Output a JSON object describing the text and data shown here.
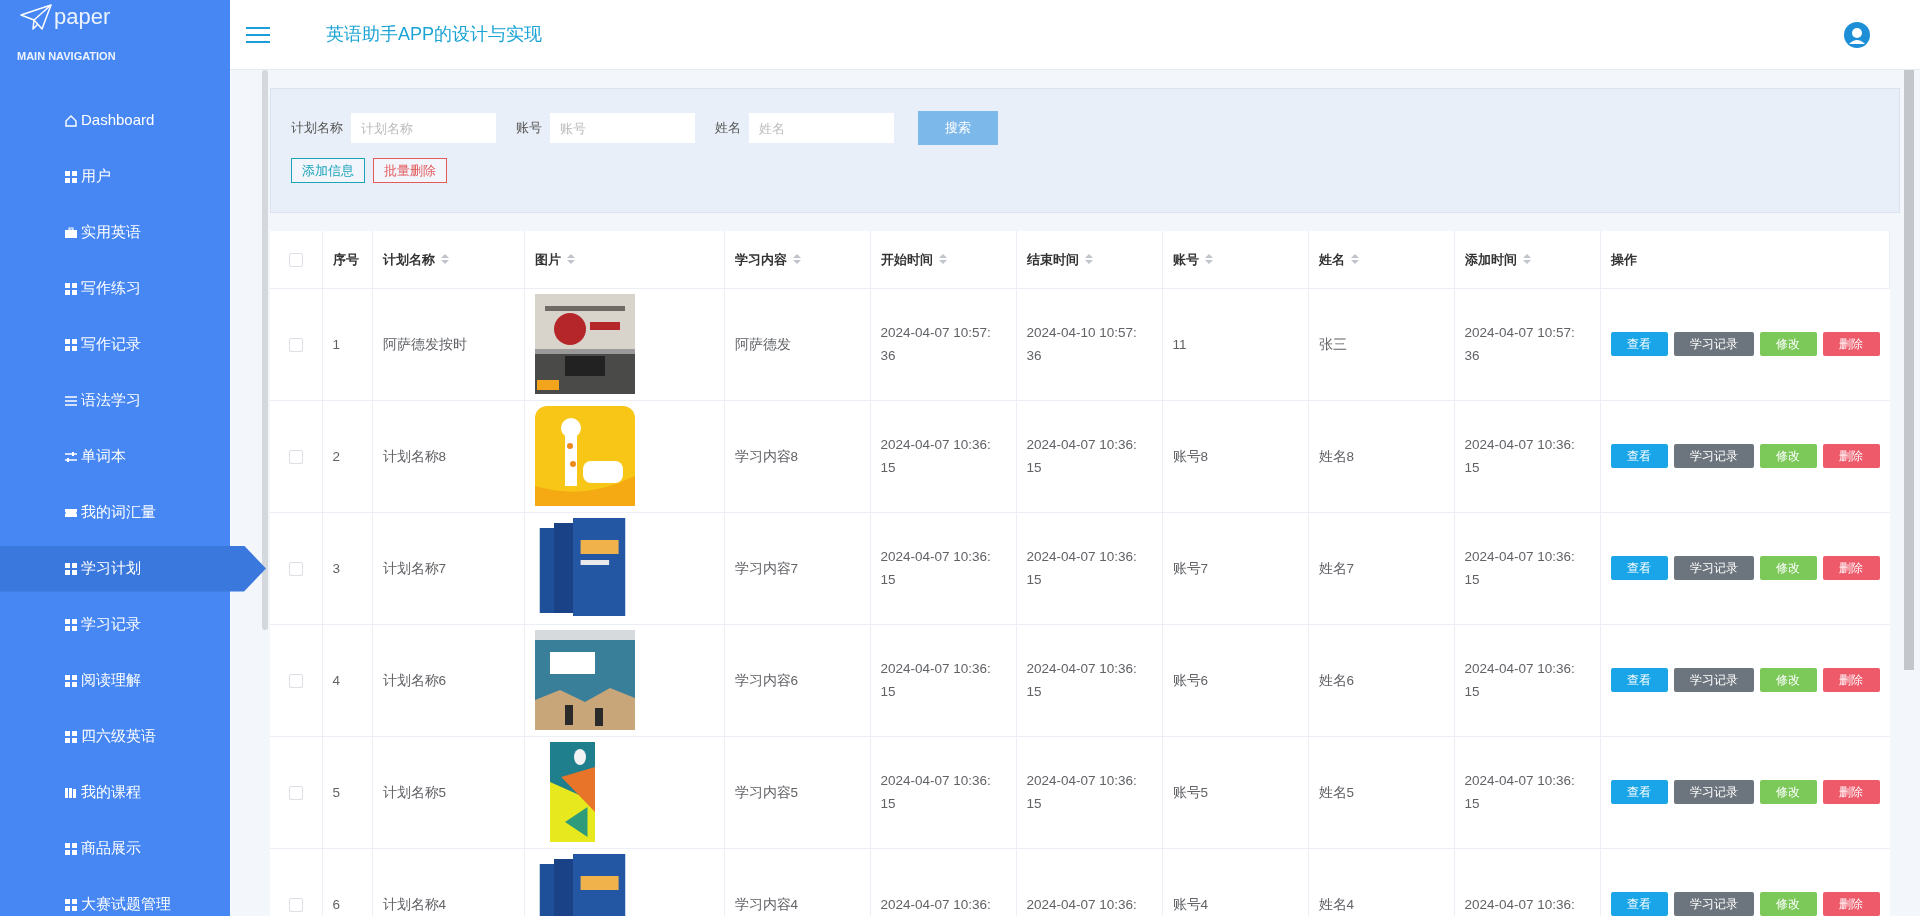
{
  "sidebar": {
    "logo": "paper",
    "section": "MAIN NAVIGATION",
    "items": [
      {
        "label": "Dashboard",
        "kind": "home",
        "selected": false
      },
      {
        "label": "用户",
        "kind": "grid",
        "selected": false
      },
      {
        "label": "实用英语",
        "kind": "briefcase",
        "selected": false
      },
      {
        "label": "写作练习",
        "kind": "grid",
        "selected": false
      },
      {
        "label": "写作记录",
        "kind": "grid",
        "selected": false
      },
      {
        "label": "语法学习",
        "kind": "list",
        "selected": false
      },
      {
        "label": "单词本",
        "kind": "sliders",
        "selected": false
      },
      {
        "label": "我的词汇量",
        "kind": "ticket",
        "selected": false
      },
      {
        "label": "学习计划",
        "kind": "grid",
        "selected": true
      },
      {
        "label": "学习记录",
        "kind": "grid",
        "selected": false
      },
      {
        "label": "阅读理解",
        "kind": "grid",
        "selected": false
      },
      {
        "label": "四六级英语",
        "kind": "grid",
        "selected": false
      },
      {
        "label": "我的课程",
        "kind": "book",
        "selected": false
      },
      {
        "label": "商品展示",
        "kind": "grid",
        "selected": false
      },
      {
        "label": "大赛试题管理",
        "kind": "grid",
        "selected": false
      }
    ]
  },
  "header": {
    "title": "英语助手APP的设计与实现"
  },
  "search": {
    "fields": [
      {
        "label": "计划名称",
        "placeholder": "计划名称"
      },
      {
        "label": "账号",
        "placeholder": "账号"
      },
      {
        "label": "姓名",
        "placeholder": "姓名"
      }
    ],
    "button": "搜索",
    "actions": [
      {
        "label": "添加信息",
        "color": "#1ba3b8"
      },
      {
        "label": "批量删除",
        "color": "#e35a5a"
      }
    ]
  },
  "table": {
    "select_all": {
      "checked": false
    },
    "columns": [
      {
        "label": "序号",
        "sortable": false
      },
      {
        "label": "计划名称",
        "sortable": true
      },
      {
        "label": "图片",
        "sortable": true
      },
      {
        "label": "学习内容",
        "sortable": true
      },
      {
        "label": "开始时间",
        "sortable": true
      },
      {
        "label": "结束时间",
        "sortable": true
      },
      {
        "label": "账号",
        "sortable": true
      },
      {
        "label": "姓名",
        "sortable": true
      },
      {
        "label": "添加时间",
        "sortable": true
      },
      {
        "label": "操作",
        "sortable": false
      }
    ],
    "rows": [
      {
        "checked": false,
        "cells": [
          "1",
          "阿萨德发按时",
          "",
          "阿萨德发",
          "2024-04-07 10:57:\n36",
          "2024-04-10 10:57:\n36",
          "11",
          "张三",
          "2024-04-07 10:57:\n36"
        ],
        "actions": [
          {
            "label": "查看",
            "color": "#1aa5e8"
          },
          {
            "label": "学习记录",
            "color": "#6c757d"
          },
          {
            "label": "修改",
            "color": "#7cc95a"
          },
          {
            "label": "删除",
            "color": "#ee5a6a"
          }
        ]
      },
      {
        "checked": false,
        "cells": [
          "2",
          "计划名称8",
          "",
          "学习内容8",
          "2024-04-07 10:36:\n15",
          "2024-04-07 10:36:\n15",
          "账号8",
          "姓名8",
          "2024-04-07 10:36:\n15"
        ],
        "actions": [
          {
            "label": "查看",
            "color": "#1aa5e8"
          },
          {
            "label": "学习记录",
            "color": "#6c757d"
          },
          {
            "label": "修改",
            "color": "#7cc95a"
          },
          {
            "label": "删除",
            "color": "#ee5a6a"
          }
        ]
      },
      {
        "checked": false,
        "cells": [
          "3",
          "计划名称7",
          "",
          "学习内容7",
          "2024-04-07 10:36:\n15",
          "2024-04-07 10:36:\n15",
          "账号7",
          "姓名7",
          "2024-04-07 10:36:\n15"
        ],
        "actions": [
          {
            "label": "查看",
            "color": "#1aa5e8"
          },
          {
            "label": "学习记录",
            "color": "#6c757d"
          },
          {
            "label": "修改",
            "color": "#7cc95a"
          },
          {
            "label": "删除",
            "color": "#ee5a6a"
          }
        ]
      },
      {
        "checked": false,
        "cells": [
          "4",
          "计划名称6",
          "",
          "学习内容6",
          "2024-04-07 10:36:\n15",
          "2024-04-07 10:36:\n15",
          "账号6",
          "姓名6",
          "2024-04-07 10:36:\n15"
        ],
        "actions": [
          {
            "label": "查看",
            "color": "#1aa5e8"
          },
          {
            "label": "学习记录",
            "color": "#6c757d"
          },
          {
            "label": "修改",
            "color": "#7cc95a"
          },
          {
            "label": "删除",
            "color": "#ee5a6a"
          }
        ]
      },
      {
        "checked": false,
        "cells": [
          "5",
          "计划名称5",
          "",
          "学习内容5",
          "2024-04-07 10:36:\n15",
          "2024-04-07 10:36:\n15",
          "账号5",
          "姓名5",
          "2024-04-07 10:36:\n15"
        ],
        "actions": [
          {
            "label": "查看",
            "color": "#1aa5e8"
          },
          {
            "label": "学习记录",
            "color": "#6c757d"
          },
          {
            "label": "修改",
            "color": "#7cc95a"
          },
          {
            "label": "删除",
            "color": "#ee5a6a"
          }
        ]
      },
      {
        "checked": false,
        "cells": [
          "6",
          "计划名称4",
          "",
          "学习内容4",
          "2024-04-07 10:36:",
          "2024-04-07 10:36:",
          "账号4",
          "姓名4",
          "2024-04-07 10:36:"
        ],
        "actions": [
          {
            "label": "查看",
            "color": "#1aa5e8"
          },
          {
            "label": "学习记录",
            "color": "#6c757d"
          },
          {
            "label": "修改",
            "color": "#7cc95a"
          },
          {
            "label": "删除",
            "color": "#ee5a6a"
          }
        ]
      }
    ]
  }
}
